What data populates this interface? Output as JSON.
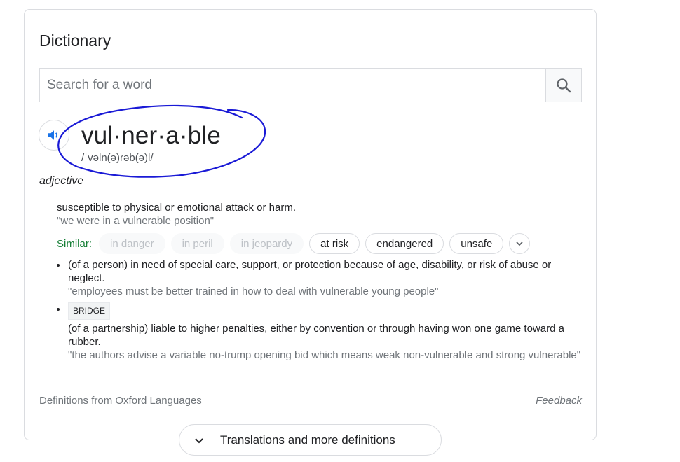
{
  "dictionary": {
    "title": "Dictionary",
    "search": {
      "placeholder": "Search for a word",
      "icon": "search-icon"
    },
    "entry": {
      "headword": "vul·ner·a·ble",
      "phonetic": "/ˈvəln(ə)rəb(ə)l/",
      "part_of_speech": "adjective",
      "senses": [
        {
          "definition": "susceptible to physical or emotional attack or harm.",
          "example": "\"we were in a vulnerable position\"",
          "similar_label": "Similar:",
          "similar": [
            "in danger",
            "in peril",
            "in jeopardy",
            "at risk",
            "endangered",
            "unsafe"
          ]
        },
        {
          "definition": "(of a person) in need of special care, support, or protection because of age, disability, or risk of abuse or neglect.",
          "example": "\"employees must be better trained in how to deal with vulnerable young people\""
        },
        {
          "label": "BRIDGE",
          "definition": "(of a partnership) liable to higher penalties, either by convention or through having won one game toward a rubber.",
          "example": "\"the authors advise a variable no-trump opening bid which means weak non-vulnerable and strong vulnerable\""
        }
      ]
    },
    "source": "Definitions from Oxford Languages",
    "feedback": "Feedback"
  },
  "more_button": {
    "label": "Translations and more definitions"
  },
  "colors": {
    "annotation": "#1a1ad6",
    "similar_label": "#188038",
    "speaker": "#1a73e8"
  }
}
